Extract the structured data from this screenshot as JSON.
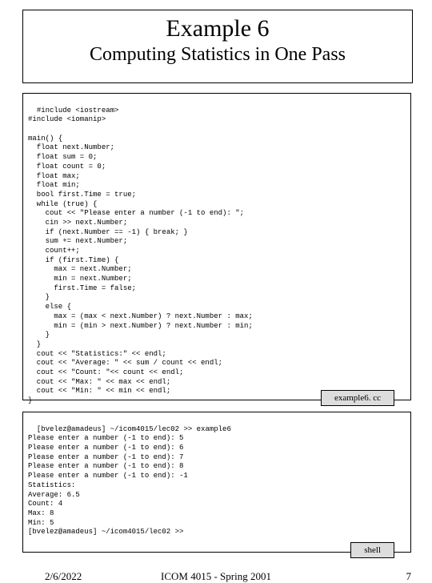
{
  "header": {
    "title": "Example 6",
    "subtitle": "Computing Statistics in One Pass"
  },
  "code_box_1": {
    "content": "#include <iostream>\n#include <iomanip>\n\nmain() {\n  float next.Number;\n  float sum = 0;\n  float count = 0;\n  float max;\n  float min;\n  bool first.Time = true;\n  while (true) {\n    cout << \"Please enter a number (-1 to end): \";\n    cin >> next.Number;\n    if (next.Number == -1) { break; }\n    sum += next.Number;\n    count++;\n    if (first.Time) {\n      max = next.Number;\n      min = next.Number;\n      first.Time = false;\n    }\n    else {\n      max = (max < next.Number) ? next.Number : max;\n      min = (min > next.Number) ? next.Number : min;\n    }\n  }\n  cout << \"Statistics:\" << endl;\n  cout << \"Average: \" << sum / count << endl;\n  cout << \"Count: \"<< count << endl;\n  cout << \"Max: \" << max << endl;\n  cout << \"Min: \" << min << endl;\n}",
    "tag": "example6. cc"
  },
  "code_box_2": {
    "content": "[bvelez@amadeus] ~/icom4015/lec02 >> example6\nPlease enter a number (-1 to end): 5\nPlease enter a number (-1 to end): 6\nPlease enter a number (-1 to end): 7\nPlease enter a number (-1 to end): 8\nPlease enter a number (-1 to end): -1\nStatistics:\nAverage: 6.5\nCount: 4\nMax: 8\nMin: 5\n[bvelez@amadeus] ~/icom4015/lec02 >>",
    "tag": "shell"
  },
  "footer": {
    "date": "2/6/2022",
    "center": "ICOM 4015 - Spring 2001",
    "pagenum": "7"
  }
}
